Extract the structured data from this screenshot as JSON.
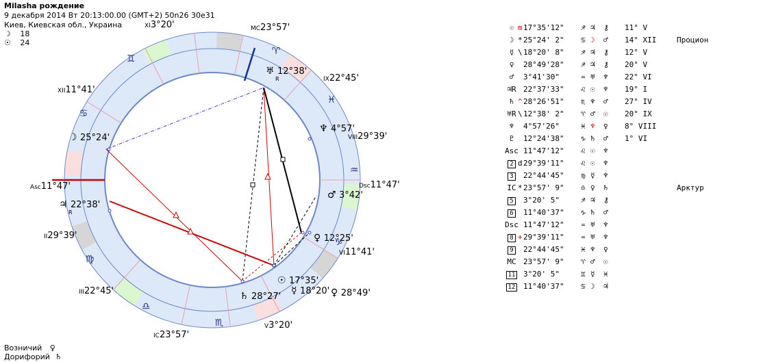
{
  "header": {
    "title": "Milasha рождение",
    "datetime": "9 декабря 2014  Вт  20:13:00.00 (GMT+2) 50n26  30e31",
    "place": "Киев, Киевская обл., Украина",
    "moon_symbol": "☽",
    "moon_count": "18",
    "sun_symbol": "☉",
    "sun_count": "24"
  },
  "colors": {
    "house_ring": "#dde8f8",
    "sign_ring_fire": "#fbdede",
    "sign_ring_earth": "#d6d6d6",
    "sign_ring_air": "#dcf6cf",
    "sign_ring_water": "#dde8f8",
    "aspect_red": "#cc0000",
    "aspect_blue": "#4b3cc8",
    "axis_red": "#cc0000",
    "axis_blue": "#1030a0"
  },
  "wheel": {
    "cusp_labels": [
      {
        "id": "xi",
        "roman": "XI",
        "deg": "3°20'"
      },
      {
        "id": "mc",
        "roman": "MC",
        "deg": "23°57'"
      },
      {
        "id": "ix",
        "roman": "IX",
        "deg": "22°45'"
      },
      {
        "id": "viii",
        "roman": "VIII",
        "deg": "29°39'"
      },
      {
        "id": "dsc",
        "roman": "Dsc",
        "deg": "11°47'"
      },
      {
        "id": "vi",
        "roman": "VI",
        "deg": "11°41'"
      },
      {
        "id": "v",
        "roman": "V",
        "deg": "3°20'"
      },
      {
        "id": "ic",
        "roman": "IC",
        "deg": "23°57'"
      },
      {
        "id": "iii",
        "roman": "III",
        "deg": "22°45'"
      },
      {
        "id": "ii",
        "roman": "II",
        "deg": "29°39'"
      },
      {
        "id": "asc",
        "roman": "Asc",
        "deg": "11°47'"
      },
      {
        "id": "xii",
        "roman": "XII",
        "deg": "11°41'"
      }
    ],
    "planet_labels": [
      {
        "id": "uranus",
        "glyph": "♅",
        "deg": "12°38'",
        "retro": "R"
      },
      {
        "id": "neptune",
        "glyph": "♆",
        "deg": "4°57'",
        "retro": ""
      },
      {
        "id": "mars",
        "glyph": "♂",
        "deg": "3°42'",
        "retro": ""
      },
      {
        "id": "venus",
        "glyph": "♀",
        "deg": "12°25'",
        "retro": ""
      },
      {
        "id": "sun",
        "glyph": "☉",
        "deg": "17°35'",
        "retro": ""
      },
      {
        "id": "saturn",
        "glyph": "♄",
        "deg": "28°27'",
        "retro": ""
      },
      {
        "id": "mercury",
        "glyph": "☿",
        "deg": "18°20'",
        "retro": ""
      },
      {
        "id": "pluto",
        "glyph": "♀",
        "deg": "28°49'",
        "retro": ""
      },
      {
        "id": "moon",
        "glyph": "☽",
        "deg": "25°24'",
        "retro": ""
      },
      {
        "id": "jupiter",
        "glyph": "♃",
        "deg": "22°38'",
        "retro": "R"
      }
    ],
    "signs": [
      {
        "id": "aries",
        "glyph": "♈"
      },
      {
        "id": "taurus",
        "glyph": "♉"
      },
      {
        "id": "gemini",
        "glyph": "♊"
      },
      {
        "id": "cancer",
        "glyph": "♋"
      },
      {
        "id": "leo",
        "glyph": "♌"
      },
      {
        "id": "virgo",
        "glyph": "♍"
      },
      {
        "id": "libra",
        "glyph": "♎"
      },
      {
        "id": "scorpio",
        "glyph": "♏"
      },
      {
        "id": "sagittarius",
        "glyph": "♐"
      },
      {
        "id": "capricorn",
        "glyph": "♑"
      },
      {
        "id": "aquarius",
        "glyph": "♒"
      },
      {
        "id": "pisces",
        "glyph": "♓"
      }
    ]
  },
  "table": [
    {
      "p": "☉",
      "pre": "m",
      "pos": "17°35'12\"",
      "sign": "♐",
      "r1": "♃",
      "r2": "⚷",
      "house": "11° V",
      "note": ""
    },
    {
      "p": "☽",
      "pre": "*",
      "pos": "25°24' 2\"",
      "sign": "♋",
      "r1": "☽",
      "r2": "♂",
      "house": "14° XII",
      "note": "Процион"
    },
    {
      "p": "☿",
      "pre": "\\",
      "pos": "18°20' 8\"",
      "sign": "♐",
      "r1": "♃",
      "r2": "⚷",
      "house": "12° V",
      "note": ""
    },
    {
      "p": "♀",
      "pre": " ",
      "pos": "28°49'28\"",
      "sign": "♐",
      "r1": "♃",
      "r2": "⚷",
      "house": "20° V",
      "note": ""
    },
    {
      "p": "♂",
      "pre": " ",
      "pos": " 3°41'30\"",
      "sign": "♒",
      "r1": "♅",
      "r2": "♆",
      "house": "22° VI",
      "note": ""
    },
    {
      "p": "♃R",
      "pre": " ",
      "pos": "22°37'33\"",
      "sign": "♌",
      "r1": "☉",
      "r2": "♆",
      "house": "19° I",
      "note": ""
    },
    {
      "p": "♄",
      "pre": "^",
      "pos": "28°26'51\"",
      "sign": "♏",
      "r1": "♆",
      "r2": "♂",
      "house": "27° IV",
      "note": ""
    },
    {
      "p": "♅R",
      "pre": "\\",
      "pos": "12°38' 2\"",
      "sign": "♈",
      "r1": "♂",
      "r2": "☉",
      "house": "20° IX",
      "note": ""
    },
    {
      "p": "♆",
      "pre": " ",
      "pos": " 4°57'26\"",
      "sign": "♓",
      "r1": "♆",
      "r2": "♀",
      "house": "8° VIII",
      "note": ""
    },
    {
      "p": "♇",
      "pre": " ",
      "pos": "12°24'38\"",
      "sign": "♑",
      "r1": "♄",
      "r2": "♂",
      "house": "1° VI",
      "note": ""
    },
    {
      "p": "Asc",
      "pre": " ",
      "pos": "11°47'12\"",
      "sign": "♌",
      "r1": "☉",
      "r2": "♆",
      "house": "",
      "note": ""
    },
    {
      "p": "2",
      "pre": "d",
      "pos": "29°39'11\"",
      "sign": "♌",
      "r1": "☉",
      "r2": "♆",
      "house": "",
      "note": "",
      "boxed": true
    },
    {
      "p": "3",
      "pre": " ",
      "pos": "22°44'45\"",
      "sign": "♍",
      "r1": "☿",
      "r2": "♆",
      "house": "",
      "note": "",
      "boxed": true
    },
    {
      "p": "IC",
      "pre": "*",
      "pos": "23°57' 9\"",
      "sign": "♎",
      "r1": "♀",
      "r2": "♄",
      "house": "",
      "note": "Арктур"
    },
    {
      "p": "5",
      "pre": " ",
      "pos": " 3°20' 5\"",
      "sign": "♐",
      "r1": "♃",
      "r2": "⚷",
      "house": "",
      "note": "",
      "boxed": true
    },
    {
      "p": "6",
      "pre": " ",
      "pos": "11°40'37\"",
      "sign": "♑",
      "r1": "♄",
      "r2": "♂",
      "house": "",
      "note": "",
      "boxed": true
    },
    {
      "p": "Dsc",
      "pre": " ",
      "pos": "11°47'12\"",
      "sign": "♒",
      "r1": "♅",
      "r2": "♆",
      "house": "",
      "note": ""
    },
    {
      "p": "8",
      "pre": "+",
      "pos": "29°39'11\"",
      "sign": "♒",
      "r1": "♅",
      "r2": "♆",
      "house": "",
      "note": "",
      "boxed": true
    },
    {
      "p": "9",
      "pre": " ",
      "pos": "22°44'45\"",
      "sign": "♓",
      "r1": "♆",
      "r2": "♀",
      "house": "",
      "note": "",
      "boxed": true
    },
    {
      "p": "MC",
      "pre": " ",
      "pos": "23°57' 9\"",
      "sign": "♈",
      "r1": "♂",
      "r2": "☉",
      "house": "",
      "note": ""
    },
    {
      "p": "11",
      "pre": " ",
      "pos": " 3°20' 5\"",
      "sign": "♊",
      "r1": "☿",
      "r2": "♓",
      "house": "",
      "note": "",
      "boxed": true
    },
    {
      "p": "12",
      "pre": " ",
      "pos": "11°40'37\"",
      "sign": "♋",
      "r1": "☽",
      "r2": "♃",
      "house": "",
      "note": "",
      "boxed": true
    }
  ],
  "footer": {
    "line1_label": "Возничий",
    "line1_glyph": "♀",
    "line2_label": "Дорифорий",
    "line2_glyph": "♄"
  }
}
